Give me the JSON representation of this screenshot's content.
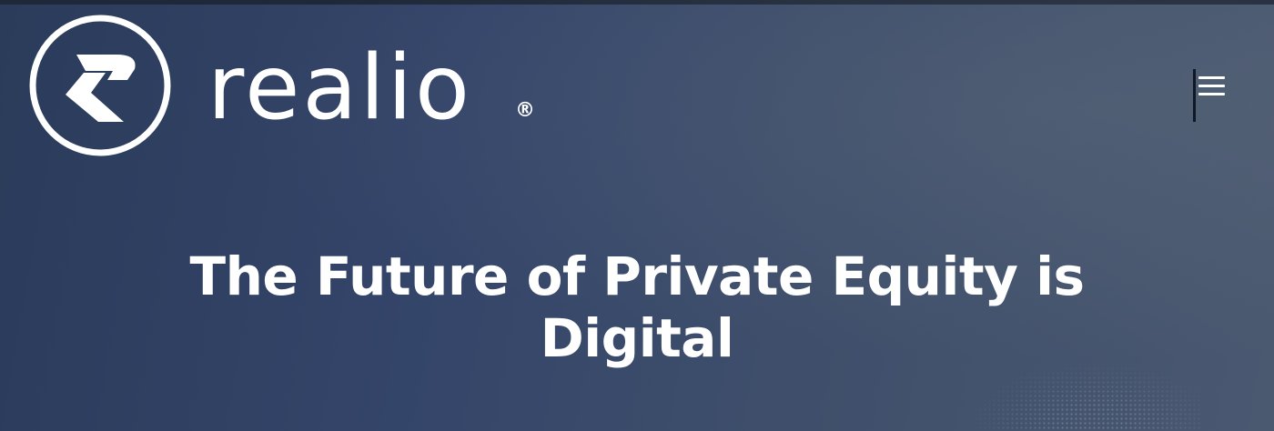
{
  "brand": {
    "name": "realio",
    "registered_mark": "®"
  },
  "header": {
    "menu_icon": "hamburger-menu-icon"
  },
  "hero": {
    "title": "The Future of Private Equity is Digital"
  },
  "colors": {
    "background_start": "#2b3b5a",
    "background_end": "#4a5870",
    "text": "#ffffff"
  }
}
